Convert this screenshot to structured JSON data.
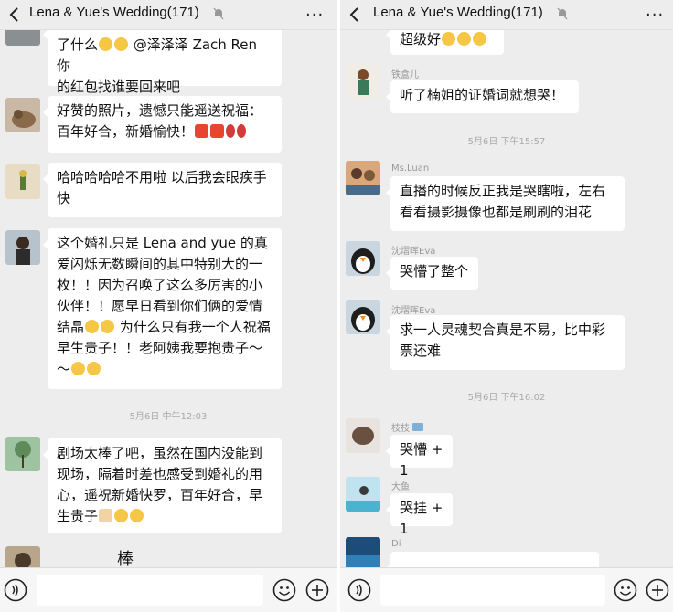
{
  "left": {
    "header": {
      "title": "Lena & Yue's Wedding(171)"
    },
    "messages": [
      {
        "text_line1": "了什么",
        "mention": "@泽泽泽 Zach Ren 你",
        "text_line2": "的红包找谁要回来吧"
      },
      {
        "text": "好赞的照片，遗憾只能遥送祝福：百年好合，新婚愉快！"
      },
      {
        "text": "哈哈哈哈哈不用啦 以后我会眼疾手快"
      },
      {
        "text": "这个婚礼只是 Lena and yue 的真爱闪烁无数瞬间的其中特别大的一枚！！因为召唤了这么多厉害的小伙伴！！愿早日看到你们俩的爱情结晶",
        "text_tail": " 为什么只有我一个人祝福早生贵子！！老阿姨我要抱贵子～～"
      },
      {
        "text": "剧场太棒了吧，虽然在国内没能到现场，隔着时差也感受到婚礼的用心，遥祝新婚快罗，百年好合，早生贵子"
      },
      {
        "text": "棒"
      }
    ],
    "timestamps": [
      "5月6日 中午12:03"
    ]
  },
  "right": {
    "header": {
      "title": "Lena & Yue's Wedding(171)"
    },
    "messages": [
      {
        "sender": "",
        "text": "超级好"
      },
      {
        "sender": "铁盒儿",
        "text": "听了楠姐的证婚词就想哭！"
      },
      {
        "sender": "Ms.Luan",
        "text": "直播的时候反正我是哭瞎啦，左右看看摄影摄像也都是刷刷的泪花"
      },
      {
        "sender": "沈熠晖Eva",
        "text": "哭懵了整个"
      },
      {
        "sender": "沈熠晖Eva",
        "text": "求一人灵魂契合真是不易，比中彩票还难"
      },
      {
        "sender": "枝枝",
        "text": "哭懵 +1"
      },
      {
        "sender": "大鱼",
        "text": "哭挂 +1"
      },
      {
        "sender": "Di",
        "text": ""
      }
    ],
    "timestamps": [
      "5月6日 下午15:57",
      "5月6日 下午16:02"
    ]
  },
  "colors": {
    "bubble": "#ffffff",
    "background": "#ededed",
    "text": "#111111",
    "meta": "#999999"
  },
  "icons": [
    "back-icon",
    "mute-bell-icon",
    "more-icon",
    "voice-icon",
    "emoji-icon",
    "plus-icon"
  ]
}
